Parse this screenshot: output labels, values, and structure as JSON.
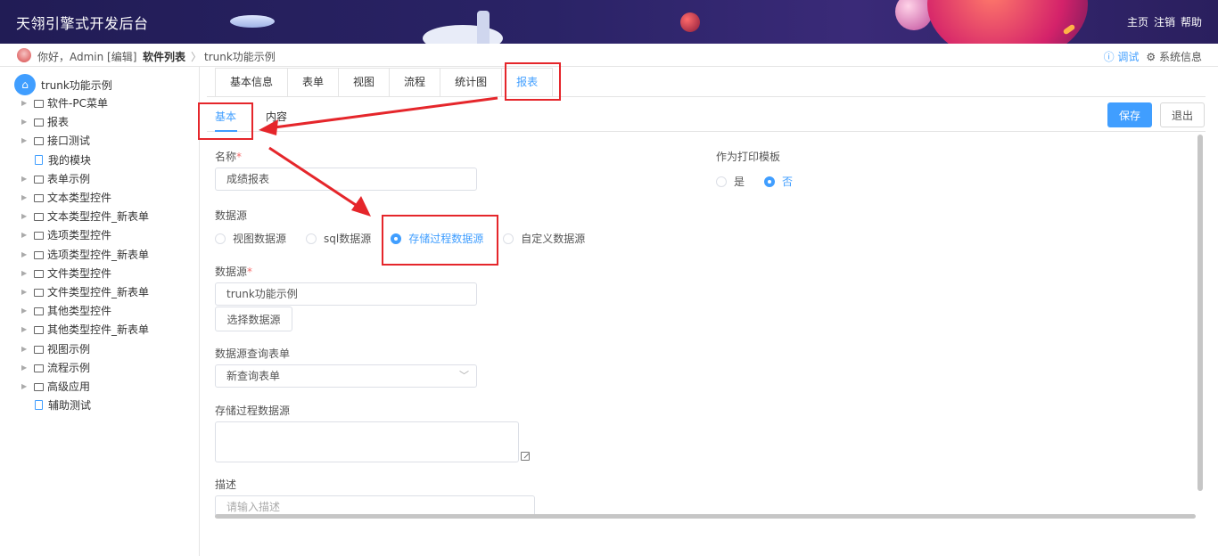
{
  "header": {
    "title": "天翎引擎式开发后台",
    "nav": [
      "主页",
      "注销",
      "帮助"
    ]
  },
  "crumbbar": {
    "greeting": "你好，Admin [编辑]",
    "crumbs": [
      "软件列表",
      "trunk功能示例"
    ],
    "separator": "〉",
    "debug": "ⓘ 调试",
    "sysinfo": "⚙ 系统信息"
  },
  "sidebar": {
    "root": "trunk功能示例",
    "items": [
      {
        "label": "软件-PC菜单",
        "type": "folder"
      },
      {
        "label": "报表",
        "type": "folder"
      },
      {
        "label": "接口测试",
        "type": "folder"
      },
      {
        "label": "我的模块",
        "type": "file"
      },
      {
        "label": "表单示例",
        "type": "folder"
      },
      {
        "label": "文本类型控件",
        "type": "folder"
      },
      {
        "label": "文本类型控件_新表单",
        "type": "folder"
      },
      {
        "label": "选项类型控件",
        "type": "folder"
      },
      {
        "label": "选项类型控件_新表单",
        "type": "folder"
      },
      {
        "label": "文件类型控件",
        "type": "folder"
      },
      {
        "label": "文件类型控件_新表单",
        "type": "folder"
      },
      {
        "label": "其他类型控件",
        "type": "folder"
      },
      {
        "label": "其他类型控件_新表单",
        "type": "folder"
      },
      {
        "label": "视图示例",
        "type": "folder"
      },
      {
        "label": "流程示例",
        "type": "folder"
      },
      {
        "label": "高级应用",
        "type": "folder"
      },
      {
        "label": "辅助测试",
        "type": "file"
      }
    ]
  },
  "tabs": [
    "基本信息",
    "表单",
    "视图",
    "流程",
    "统计图",
    "报表"
  ],
  "subtabs": [
    "基本",
    "内容"
  ],
  "toolbar": {
    "save": "保存",
    "exit": "退出"
  },
  "form": {
    "name_label": "名称",
    "name_value": "成绩报表",
    "print_label": "作为打印模板",
    "print_options": [
      "是",
      "否"
    ],
    "print_selected": "否",
    "source_label": "数据源",
    "source_options": [
      "视图数据源",
      "sql数据源",
      "存储过程数据源",
      "自定义数据源"
    ],
    "source_selected": "存储过程数据源",
    "ds_label": "数据源",
    "ds_value": "trunk功能示例",
    "choose_ds": "选择数据源",
    "query_form_label": "数据源查询表单",
    "query_form_value": "新查询表单",
    "sp_label": "存储过程数据源",
    "sp_value": "",
    "desc_label": "描述",
    "desc_placeholder": "请输入描述",
    "required_mark": "*"
  },
  "colors": {
    "accent": "#409eff",
    "annotation": "#e5262b",
    "header_bg": "#211c55"
  }
}
